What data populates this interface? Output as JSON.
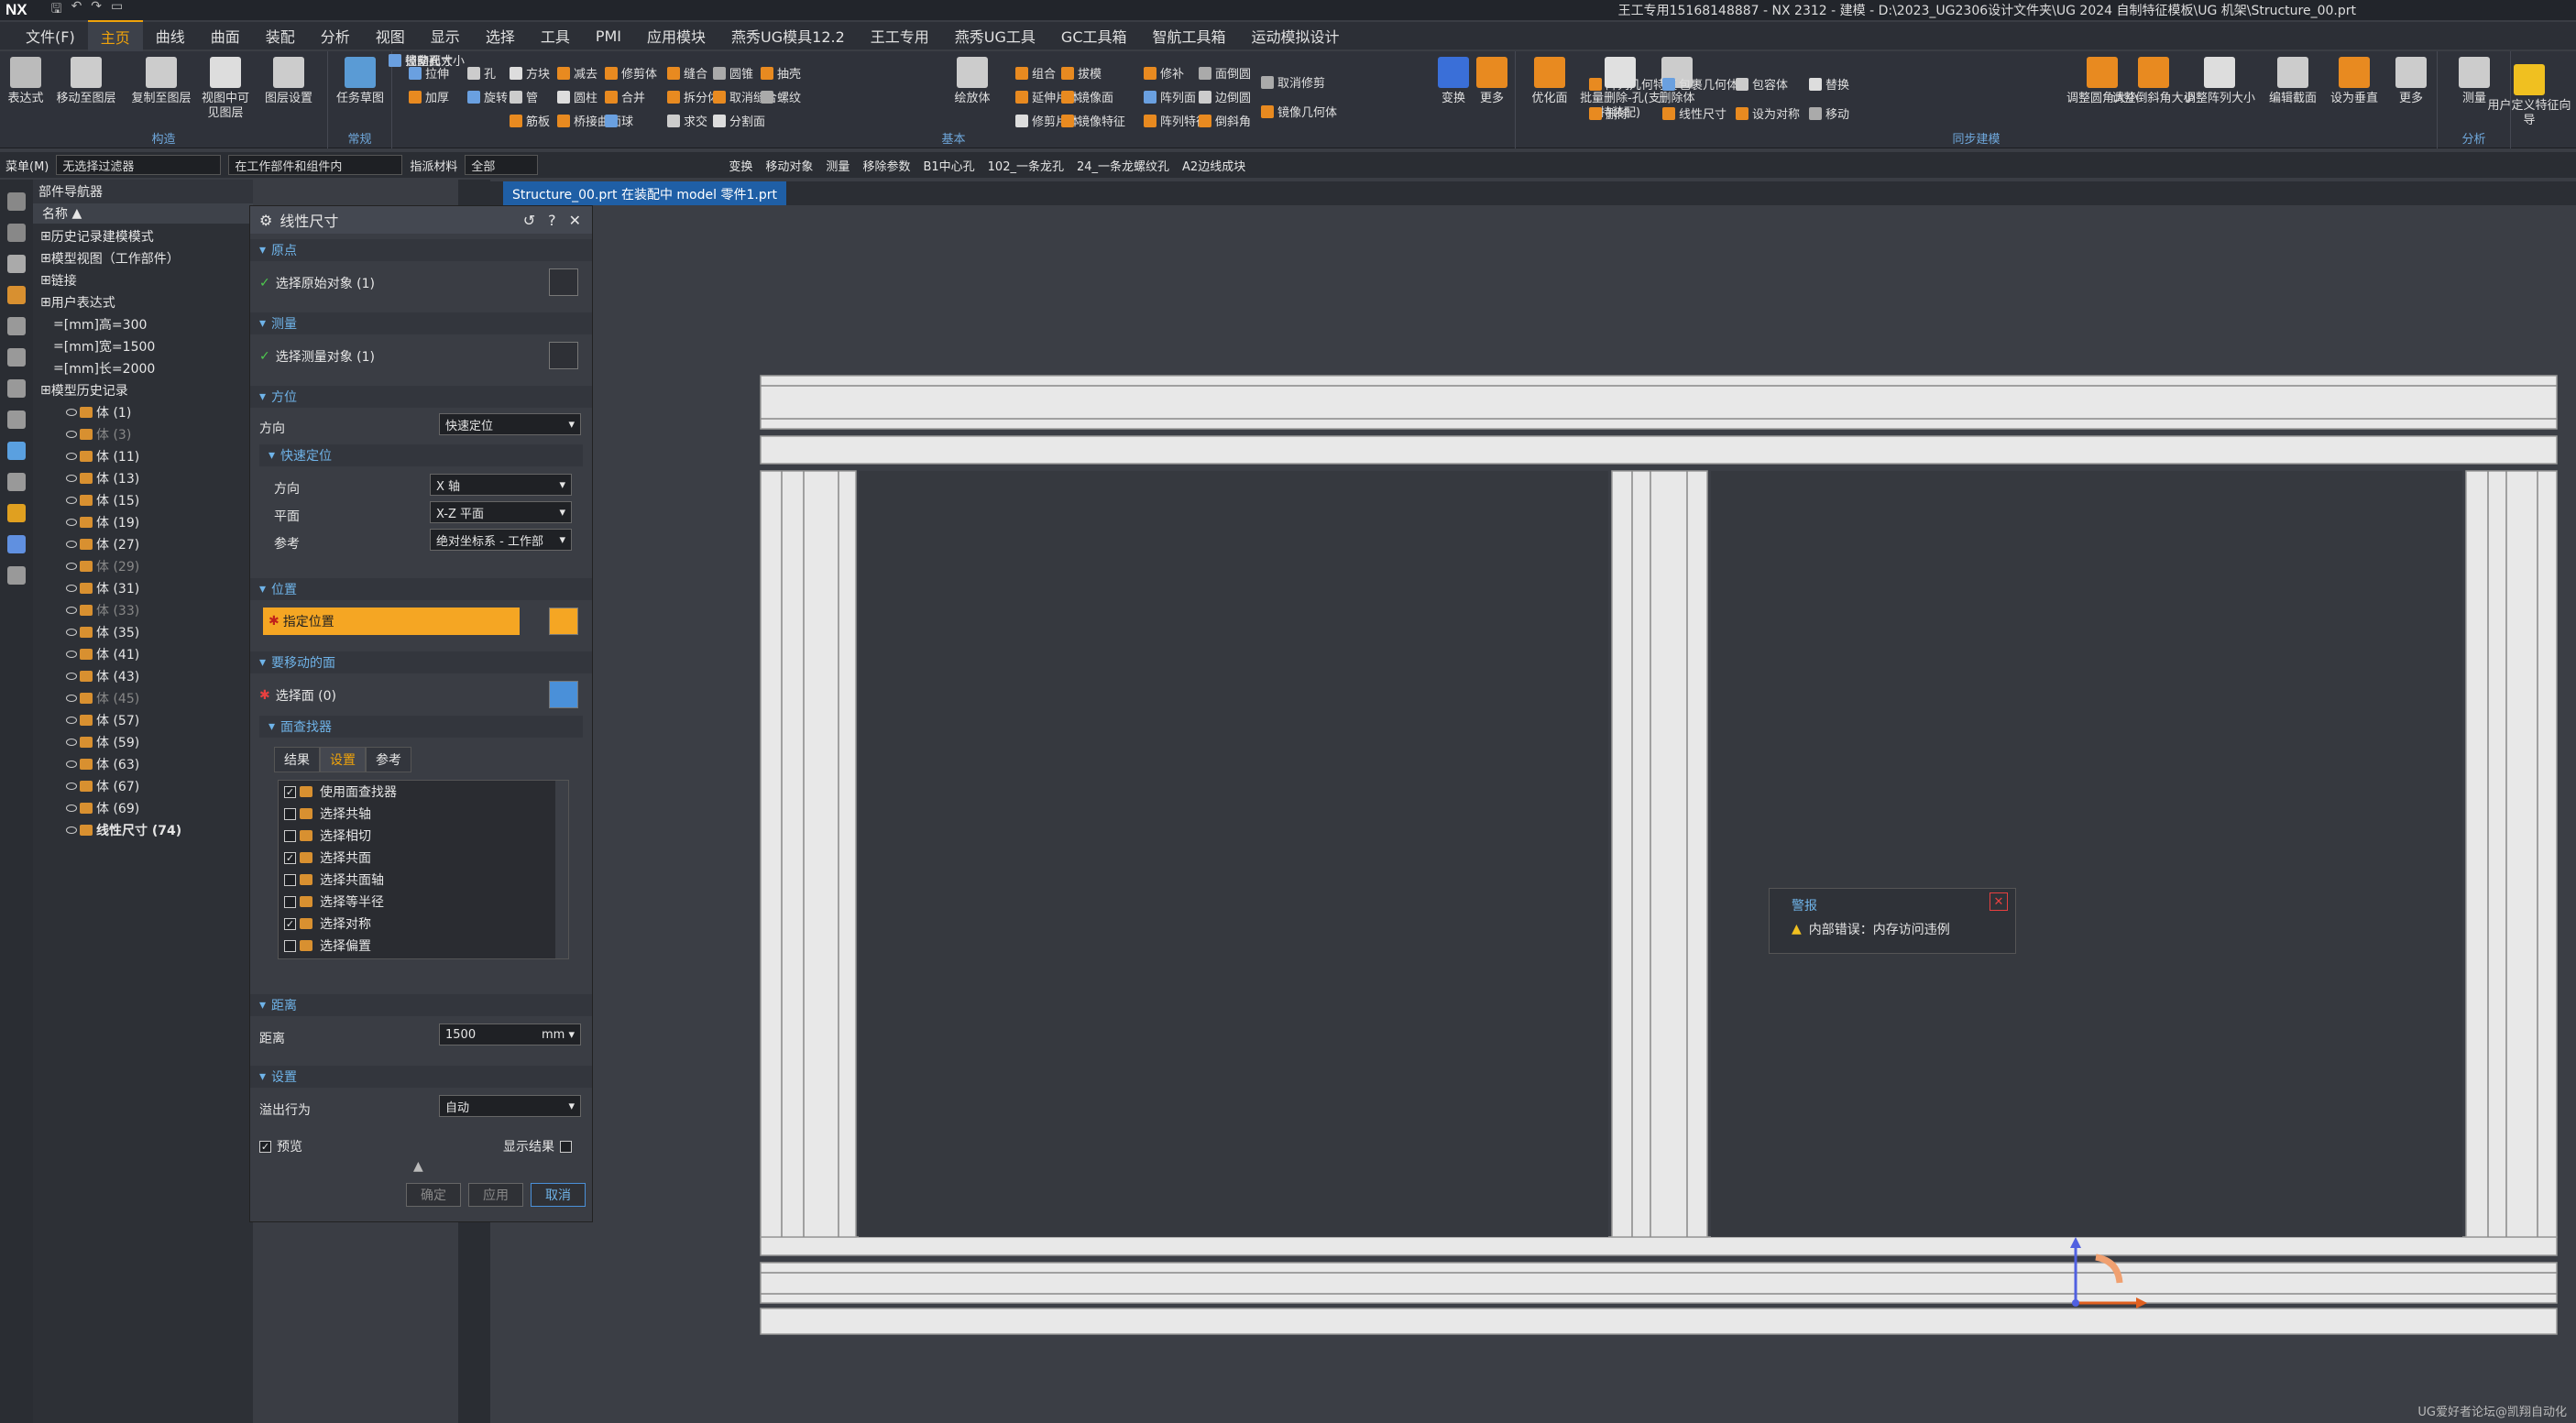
{
  "app": {
    "logo": "NX",
    "window_title": "王工专用15168148887 - NX 2312 - 建模 - D:\\2023_UG2306设计文件夹\\UG 2024 自制特征模板\\UG 机架\\Structure_00.prt"
  },
  "menu_tabs": [
    "文件(F)",
    "主页",
    "曲线",
    "曲面",
    "装配",
    "分析",
    "视图",
    "显示",
    "选择",
    "工具",
    "PMI",
    "应用模块",
    "燕秀UG模具12.2",
    "王工专用",
    "燕秀UG工具",
    "GC工具箱",
    "智航工具箱",
    "运动模拟设计"
  ],
  "ribbon": {
    "groups": {
      "construct": "构造",
      "routine": "常规",
      "basic": "基本",
      "sync": "同步建模",
      "analysis": "分析"
    },
    "buttons": {
      "b1": "表达式",
      "b2": "移动至图层",
      "b3": "复制至图层",
      "b4": "视图中可见图层",
      "b5": "图层设置",
      "b6": "任务草图",
      "b7": "绘放体",
      "b8": "变换",
      "b9": "更多",
      "b10": "优化面",
      "b11": "批量删除-孔(支持装配)",
      "b12": "删除体",
      "b13": "调整圆角大小",
      "b14": "调整倒斜角大小",
      "b15": "调整阵列大小",
      "b16": "编辑截面",
      "b17": "设为垂直",
      "b18": "更多",
      "b19": "测量",
      "b20": "用户定义特征向导"
    },
    "small": [
      "拉伸",
      "孔",
      "方块",
      "减去",
      "修剪体",
      "缝合",
      "圆锥",
      "抽壳",
      "加厚",
      "旋转",
      "管",
      "圆柱",
      "合并",
      "拆分体",
      "取消缝合",
      "螺纹",
      "筋板",
      "桥接曲面",
      "球",
      "求交",
      "分割面",
      "组合",
      "拔模",
      "修补",
      "面倒圆",
      "延伸片体",
      "镜像面",
      "阵列面",
      "边倒圆",
      "修剪片体",
      "镜像特征",
      "阵列特征",
      "倒斜角",
      "取消修剪",
      "镜像几何体",
      "阵列几何特征",
      "包裹几何体",
      "包容体",
      "替换",
      "删除",
      "线性尺寸",
      "设为对称",
      "移动",
      "拉动面",
      "径向尺寸",
      "调整孔大小"
    ]
  },
  "cmdbar": {
    "menu": "菜单(M)",
    "filter": "无选择过滤器",
    "scope": "在工作部件和组件内",
    "material": "指派材料",
    "all": "全部",
    "items": [
      "变换",
      "移动对象",
      "测量",
      "移除参数",
      "B1中心孔",
      "102_一条龙孔",
      "24_一条龙螺纹孔",
      "A2边线成块"
    ]
  },
  "doc_tab": "Structure_00.prt 在装配中 model 零件1.prt",
  "navigator": {
    "title": "部件导航器",
    "col": "名称",
    "rows": [
      {
        "t": "历史记录建模模式",
        "lvl": 0
      },
      {
        "t": "模型视图（工作部件）",
        "lvl": 0
      },
      {
        "t": "链接",
        "lvl": 0
      },
      {
        "t": "用户表达式",
        "lvl": 0
      },
      {
        "t": "[mm]高=300",
        "lvl": 1
      },
      {
        "t": "[mm]宽=1500",
        "lvl": 1
      },
      {
        "t": "[mm]长=2000",
        "lvl": 1
      },
      {
        "t": "模型历史记录",
        "lvl": 0
      },
      {
        "t": "体 (1)",
        "lvl": 2
      },
      {
        "t": "体 (3)",
        "lvl": 2,
        "dim": true
      },
      {
        "t": "体 (11)",
        "lvl": 2
      },
      {
        "t": "体 (13)",
        "lvl": 2
      },
      {
        "t": "体 (15)",
        "lvl": 2
      },
      {
        "t": "体 (19)",
        "lvl": 2
      },
      {
        "t": "体 (27)",
        "lvl": 2
      },
      {
        "t": "体 (29)",
        "lvl": 2,
        "dim": true
      },
      {
        "t": "体 (31)",
        "lvl": 2
      },
      {
        "t": "体 (33)",
        "lvl": 2,
        "dim": true
      },
      {
        "t": "体 (35)",
        "lvl": 2
      },
      {
        "t": "体 (41)",
        "lvl": 2
      },
      {
        "t": "体 (43)",
        "lvl": 2
      },
      {
        "t": "体 (45)",
        "lvl": 2,
        "dim": true
      },
      {
        "t": "体 (57)",
        "lvl": 2
      },
      {
        "t": "体 (59)",
        "lvl": 2
      },
      {
        "t": "体 (63)",
        "lvl": 2
      },
      {
        "t": "体 (67)",
        "lvl": 2
      },
      {
        "t": "体 (69)",
        "lvl": 2
      },
      {
        "t": "线性尺寸 (74)",
        "lvl": 2,
        "bold": true
      }
    ]
  },
  "dialog": {
    "title": "线性尺寸",
    "origin": {
      "hdr": "原点",
      "sel": "选择原始对象 (1)"
    },
    "measure": {
      "hdr": "测量",
      "sel": "选择测量对象 (1)"
    },
    "orient": {
      "hdr": "方位",
      "dir_label": "方向",
      "dir_value": "快速定位",
      "quick_hdr": "快速定位",
      "q_dir_label": "方向",
      "q_dir_value": "X 轴",
      "plane_label": "平面",
      "plane_value": "X-Z 平面",
      "ref_label": "参考",
      "ref_value": "绝对坐标系 - 工作部"
    },
    "position": {
      "hdr": "位置",
      "spec": "指定位置"
    },
    "faces": {
      "hdr": "要移动的面",
      "sel": "选择面 (0)",
      "finder_hdr": "面查找器",
      "tabs": [
        "结果",
        "设置",
        "参考"
      ],
      "items": [
        {
          "t": "使用面查找器",
          "c": true
        },
        {
          "t": "选择共轴",
          "c": false
        },
        {
          "t": "选择相切",
          "c": false
        },
        {
          "t": "选择共面",
          "c": true
        },
        {
          "t": "选择共面轴",
          "c": false
        },
        {
          "t": "选择等半径",
          "c": false
        },
        {
          "t": "选择对称",
          "c": true
        },
        {
          "t": "选择偏置",
          "c": false
        }
      ]
    },
    "distance": {
      "hdr": "距离",
      "label": "距离",
      "value": "1500",
      "unit": "mm"
    },
    "settings": {
      "hdr": "设置",
      "overflow_label": "溢出行为",
      "overflow_value": "自动"
    },
    "preview": "预览",
    "show_result": "显示结果",
    "buttons": {
      "ok": "确定",
      "apply": "应用",
      "cancel": "取消"
    }
  },
  "alert": {
    "title": "警报",
    "message": "内部错误：内存访问违例"
  },
  "watermark": "UG爱好者论坛@凯翔自动化",
  "colors": {
    "accent": "#f0a30a",
    "highlight": "#f5a623",
    "link": "#6fb3e8"
  }
}
